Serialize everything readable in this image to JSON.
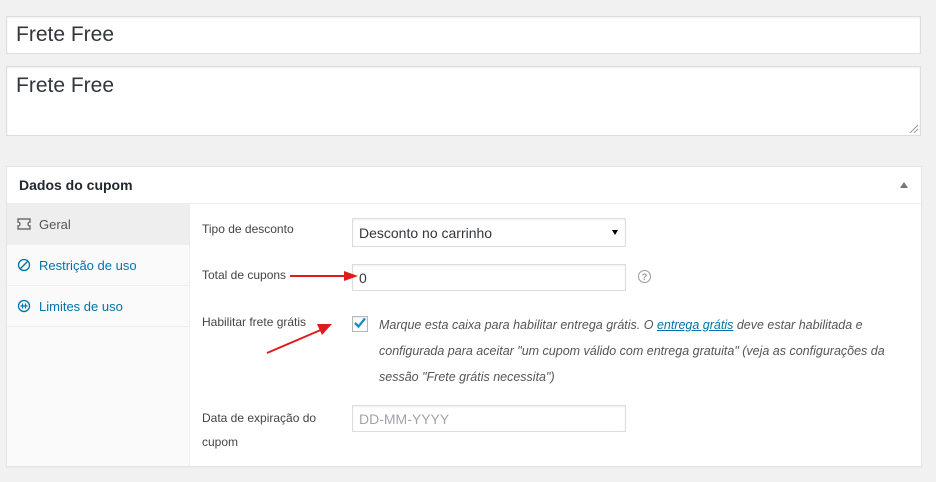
{
  "title_input": {
    "value": "Frete Free"
  },
  "description": {
    "value": "Frete Free"
  },
  "coupon_box": {
    "title": "Dados do cupom",
    "tabs": [
      {
        "label": "Geral",
        "icon": "ticket-icon"
      },
      {
        "label": "Restrição de uso",
        "icon": "restriction-icon"
      },
      {
        "label": "Limites de uso",
        "icon": "limits-icon"
      }
    ],
    "fields": {
      "discount_type": {
        "label": "Tipo de desconto",
        "value": "Desconto no carrinho"
      },
      "coupon_amount": {
        "label": "Total de cupons",
        "value": "0"
      },
      "free_shipping": {
        "label": "Habilitar frete grátis",
        "checked": true,
        "desc_before": "Marque esta caixa para habilitar entrega grátis. O ",
        "link_text": "entrega grátis",
        "desc_after": " deve estar habilitada e configurada para aceitar \"um cupom válido com entrega gratuita\" (veja as configurações da sessão \"Frete grátis necessita\")"
      },
      "expiry_date": {
        "label": "Data de expiração do cupom",
        "placeholder": "DD-MM-YYYY"
      }
    }
  },
  "colors": {
    "arrow": "#e01b1b",
    "link": "#0073aa"
  }
}
